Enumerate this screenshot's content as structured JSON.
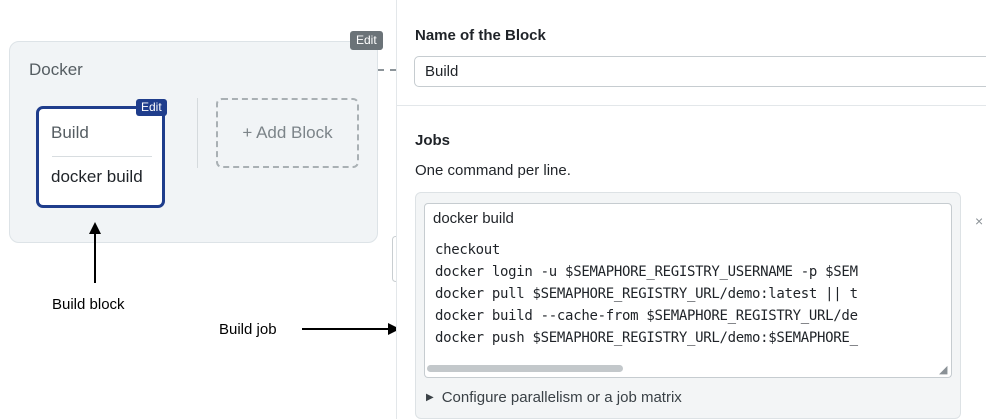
{
  "canvas": {
    "pipeline": {
      "edit_label": "Edit",
      "name": "Docker"
    },
    "block": {
      "edit_label": "Edit",
      "name": "Build",
      "job": "docker build"
    },
    "add_block_label": "+ Add Block",
    "annotations": {
      "build_block": "Build block",
      "build_job": "Build job"
    }
  },
  "panel": {
    "name_heading": "Name of the Block",
    "name_value": "Build",
    "jobs_heading": "Jobs",
    "jobs_subtitle": "One command per line.",
    "job": {
      "close_icon": "×",
      "name_value": "docker build",
      "commands": [
        "checkout",
        "docker login -u $SEMAPHORE_REGISTRY_USERNAME -p $SEM",
        "docker pull $SEMAPHORE_REGISTRY_URL/demo:latest || t",
        "docker build --cache-from $SEMAPHORE_REGISTRY_URL/de",
        "docker push $SEMAPHORE_REGISTRY_URL/demo:$SEMAPHORE_"
      ]
    },
    "configure_label": "Configure parallelism or a job matrix"
  },
  "icons": {
    "close": "close-icon",
    "disclosure": "triangle-right-icon",
    "resize": "resize-grip-icon"
  },
  "colors": {
    "selected_block": "#1f3d8c",
    "pipeline_bg": "#f1f4f6",
    "edit_badge": "#6b7378"
  }
}
